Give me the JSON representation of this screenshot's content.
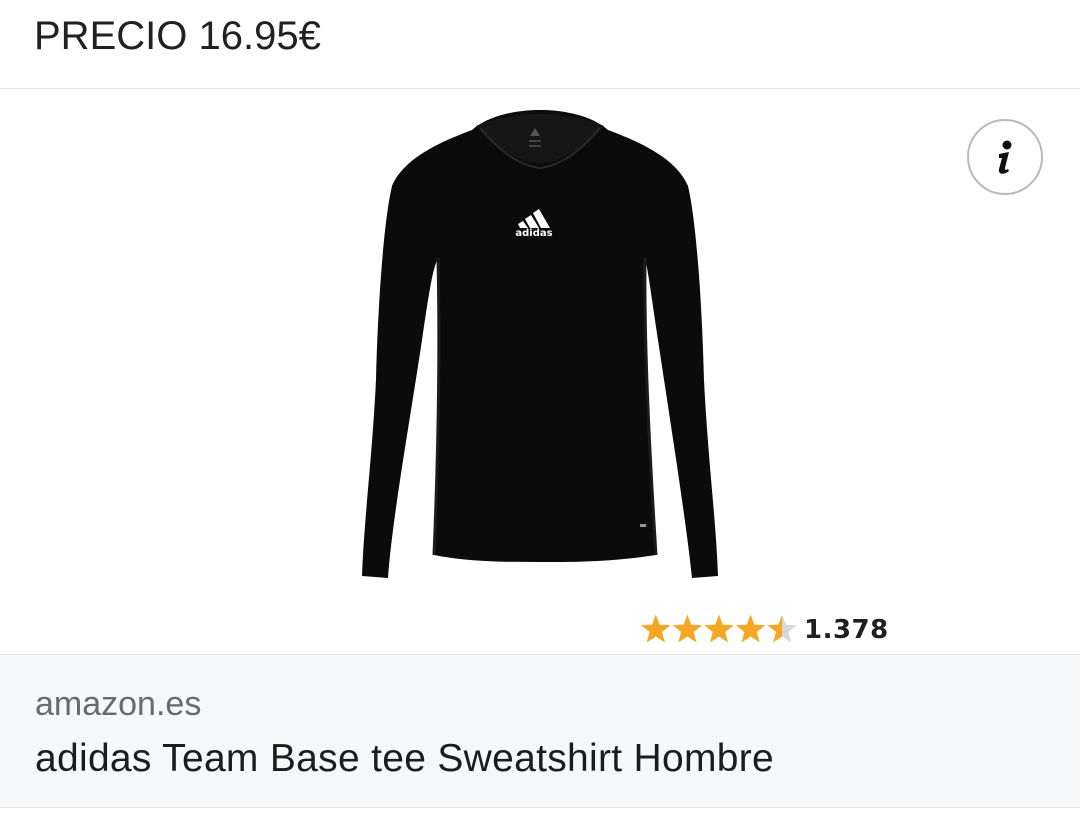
{
  "header": {
    "price_text": "PRECIO 16.95€"
  },
  "product": {
    "image_icon": "long-sleeve-shirt-image",
    "logo_text": "adidas",
    "info_icon": "info-icon",
    "rating": {
      "stars": 4.5,
      "max_stars": 5,
      "count": "1.378",
      "star_color": "#f5a623"
    }
  },
  "footer": {
    "domain": "amazon.es",
    "title": "adidas Team Base tee Sweatshirt Hombre"
  },
  "colors": {
    "link_blue": "#1a6ed8",
    "footer_bg": "#f6f7f9"
  }
}
